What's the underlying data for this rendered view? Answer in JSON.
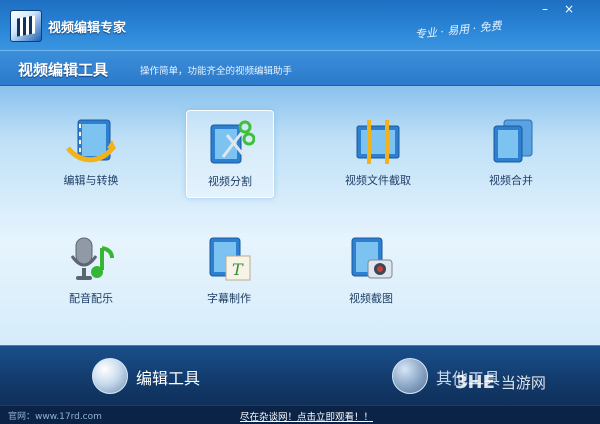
{
  "app": {
    "title": "视频编辑专家",
    "slogan": "专业 · 易用 · 免费"
  },
  "window_controls": {
    "minimize": "–",
    "close": "×"
  },
  "header": {
    "title": "视频编辑工具",
    "subtitle": "操作简单，功能齐全的视频编辑助手"
  },
  "tools": [
    {
      "label": "编辑与转换",
      "icon": "film-convert-icon"
    },
    {
      "label": "视频分割",
      "icon": "film-scissors-icon",
      "selected": true
    },
    {
      "label": "视频文件截取",
      "icon": "film-cut-icon"
    },
    {
      "label": "视频合并",
      "icon": "film-merge-icon"
    },
    {
      "label": "配音配乐",
      "icon": "microphone-music-icon"
    },
    {
      "label": "字幕制作",
      "icon": "film-subtitle-icon"
    },
    {
      "label": "视频截图",
      "icon": "film-camera-icon"
    }
  ],
  "bottom": {
    "edit_tools": "编辑工具",
    "other_tools": "其他工具"
  },
  "status": {
    "site": "官网：www.17rd.com",
    "link": "尽在杂谈网！点击立即观看！！"
  },
  "watermark": {
    "logo": "3HE",
    "text": "当游网"
  },
  "colors": {
    "accent": "#2b86d8",
    "bottom_bar": "#123a6b"
  }
}
